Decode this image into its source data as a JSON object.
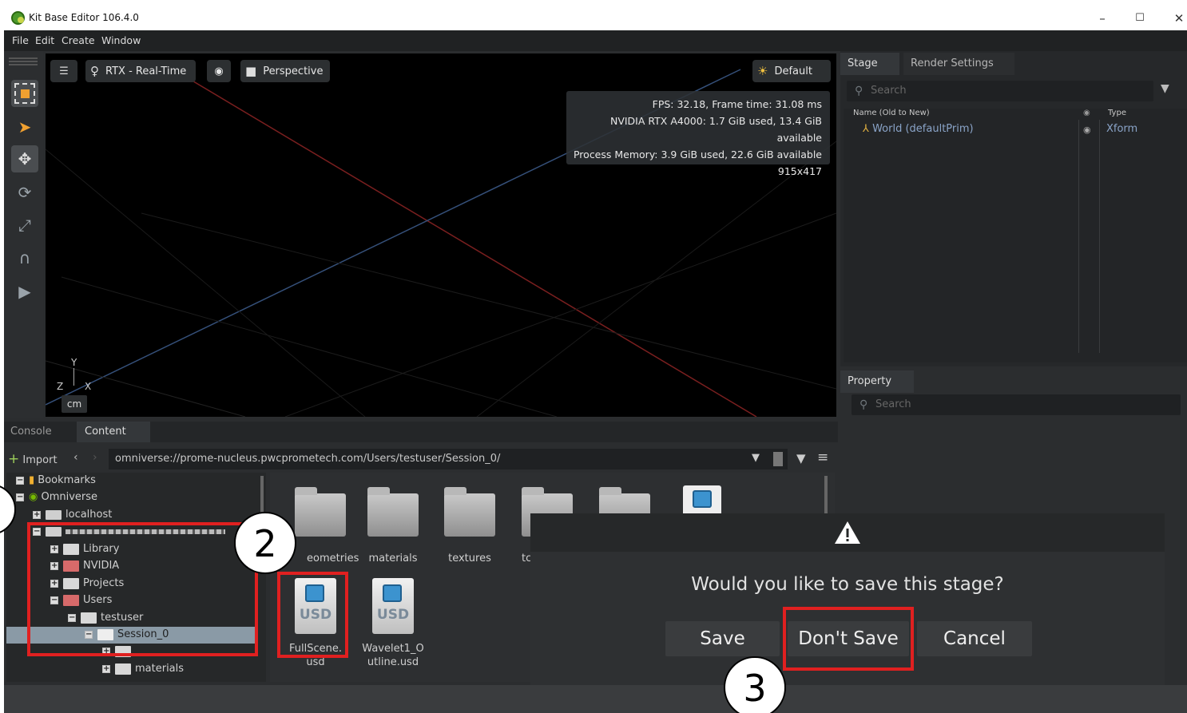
{
  "window": {
    "title": "Kit Base Editor 106.4.0",
    "controls": {
      "minimize": "–",
      "maximize": "☐",
      "close": "✕"
    }
  },
  "menu": [
    "File",
    "Edit",
    "Create",
    "Window"
  ],
  "viewport": {
    "renderer_label": "RTX - Real-Time",
    "camera_label": "Perspective",
    "lighting_label": "Default",
    "stats": [
      "FPS: 32.18, Frame time: 31.08 ms",
      "NVIDIA RTX A4000: 1.7 GiB used, 13.4 GiB available",
      "Process Memory: 3.9 GiB used, 22.6 GiB available",
      "915x417"
    ],
    "axis_labels": {
      "y": "Y",
      "z": "Z",
      "x": "X"
    },
    "unit": "cm"
  },
  "stage": {
    "tabs": [
      "Stage",
      "Render Settings"
    ],
    "search_placeholder": "Search",
    "columns": {
      "name": "Name (Old to New)",
      "type": "Type"
    },
    "rows": [
      {
        "name": "World (defaultPrim)",
        "type": "Xform"
      }
    ]
  },
  "property": {
    "tab": "Property",
    "search_placeholder": "Search"
  },
  "content": {
    "tabs": [
      "Console",
      "Content"
    ],
    "import_label": "Import",
    "address": "omniverse://prome-nucleus.pwcprometech.com/Users/testuser/Session_0/",
    "tree": {
      "bookmarks": "Bookmarks",
      "omniverse": "Omniverse",
      "localhost": "localhost",
      "library": "Library",
      "nvidia": "NVIDIA",
      "projects": "Projects",
      "users": "Users",
      "testuser": "testuser",
      "session": "Session_0",
      "materials": "materials"
    },
    "grid": {
      "folders": [
        "eometries",
        "materials",
        "textures",
        "tc"
      ],
      "files": [
        {
          "l1": "FullScene.",
          "l2": "usd"
        },
        {
          "l1": "Wavelet1_O",
          "l2": "utline.usd"
        }
      ],
      "usd_badge": "USD"
    }
  },
  "dialog": {
    "icon": "warning-icon",
    "message": "Would you like to save this stage?",
    "buttons": {
      "save": "Save",
      "dont_save": "Don't Save",
      "cancel": "Cancel"
    }
  },
  "annotations": {
    "step2": "2",
    "step3": "3"
  },
  "colors": {
    "highlight": "#e02020",
    "viewport_bg": "#000000",
    "panel_bg": "#2b2d2f"
  }
}
